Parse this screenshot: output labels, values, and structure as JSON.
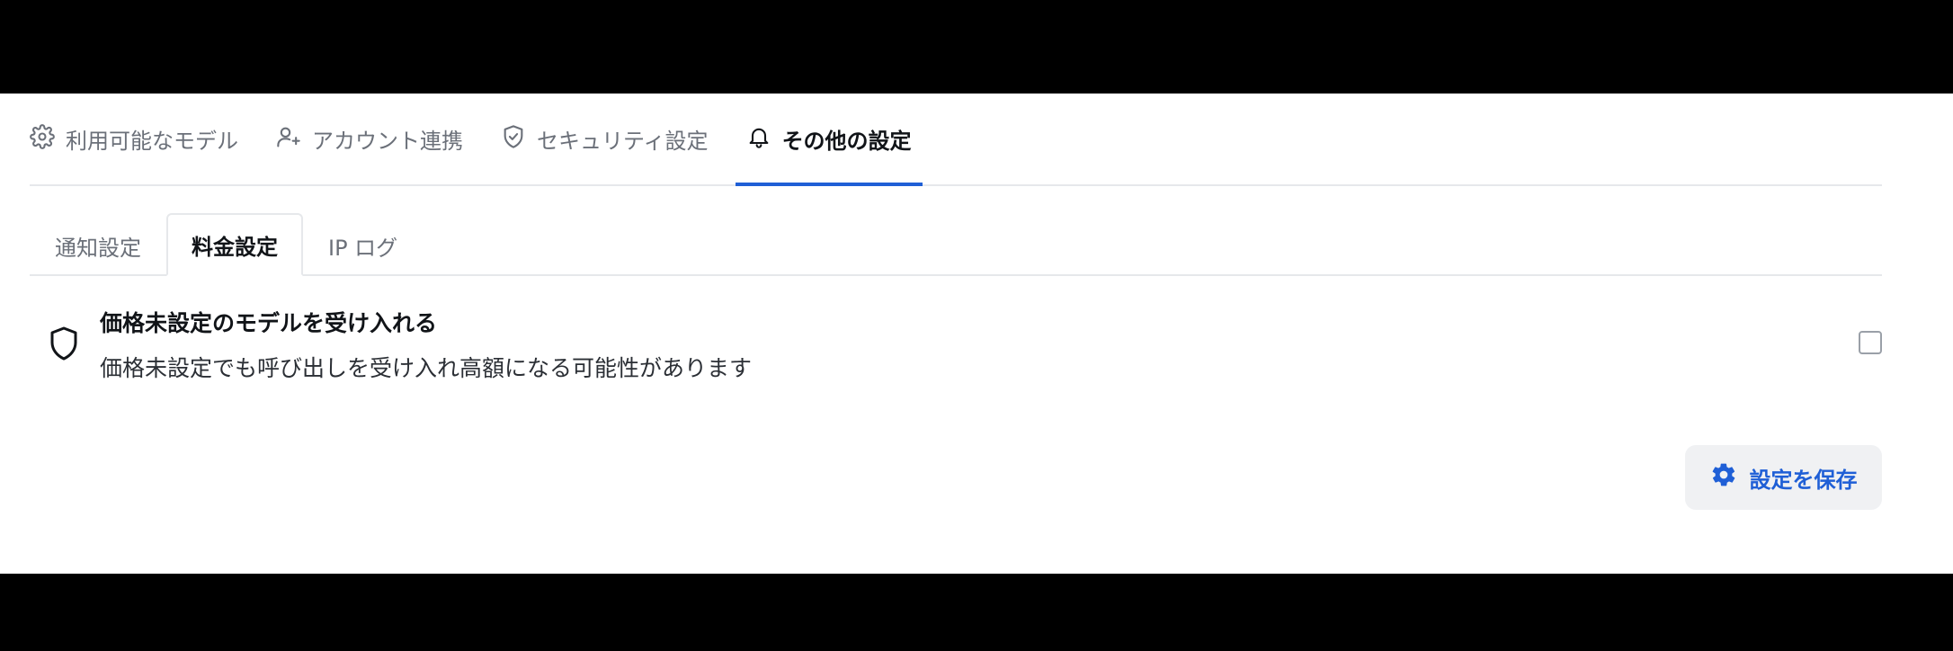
{
  "main_tabs": [
    {
      "label": "利用可能なモデル",
      "icon": "gear-icon"
    },
    {
      "label": "アカウント連携",
      "icon": "user-plus-icon"
    },
    {
      "label": "セキュリティ設定",
      "icon": "shield-check-icon"
    },
    {
      "label": "その他の設定",
      "icon": "bell-icon",
      "active": true
    }
  ],
  "sub_tabs": [
    {
      "label": "通知設定"
    },
    {
      "label": "料金設定",
      "active": true
    },
    {
      "label": "IP ログ"
    }
  ],
  "setting": {
    "icon": "shield-icon",
    "title": "価格未設定のモデルを受け入れる",
    "description": "価格未設定でも呼び出しを受け入れ高額になる可能性があります",
    "checked": false
  },
  "save_button": {
    "label": "設定を保存",
    "icon": "gear-icon"
  },
  "colors": {
    "accent": "#1f5fd6",
    "border": "#e6e8eb",
    "muted_text": "#6b7079",
    "button_bg": "#f0f1f3"
  }
}
